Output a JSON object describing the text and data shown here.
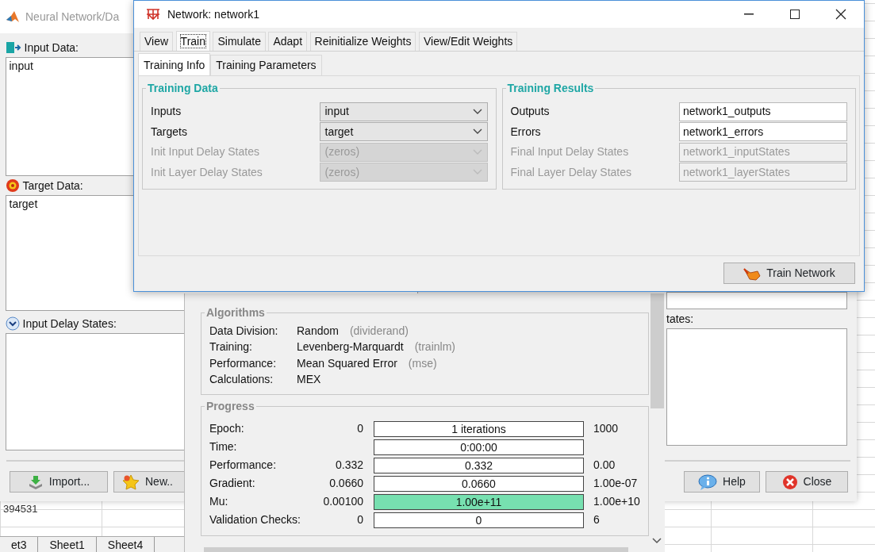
{
  "spreadsheet": {
    "cell_text": "394531",
    "sheet_tabs": [
      {
        "label": "et3"
      },
      {
        "label": "Sheet1"
      },
      {
        "label": "Sheet4"
      }
    ]
  },
  "data_manager": {
    "title": "Neural Network/Da",
    "input_data": {
      "label": "Input Data:",
      "items": [
        "input"
      ]
    },
    "target_data": {
      "label": "Target Data:",
      "items": [
        "target"
      ]
    },
    "input_delay_states": {
      "label": "Input Delay States:"
    },
    "right_states": {
      "label": "tates:"
    },
    "buttons": [
      {
        "label": "Import...",
        "kind": "import"
      },
      {
        "label": "New..",
        "kind": "new"
      },
      {
        "label": "Help",
        "kind": "help"
      },
      {
        "label": "Close",
        "kind": "close"
      }
    ]
  },
  "training_tool": {
    "algorithms": {
      "title": "Algorithms",
      "rows": [
        {
          "label": "Data Division:",
          "value": "Random",
          "function": "(dividerand)"
        },
        {
          "label": "Training:",
          "value": "Levenberg-Marquardt",
          "function": "(trainlm)"
        },
        {
          "label": "Performance:",
          "value": "Mean Squared Error",
          "function": "(mse)"
        },
        {
          "label": "Calculations:",
          "value": "MEX"
        }
      ]
    },
    "progress": {
      "title": "Progress",
      "rows": [
        {
          "label": "Epoch:",
          "start": "0",
          "bar_text": "1 iterations",
          "level": 0,
          "end": "1000"
        },
        {
          "label": "Time:",
          "bar_text": "0:00:00",
          "level": 0
        },
        {
          "label": "Performance:",
          "start": "0.332",
          "bar_text": "0.332",
          "level": 0,
          "end": "0.00"
        },
        {
          "label": "Gradient:",
          "start": "0.0660",
          "bar_text": "0.0660",
          "level": 0,
          "end": "1.00e-07"
        },
        {
          "label": "Mu:",
          "start": "0.00100",
          "bar_text": "1.00e+11",
          "level": 1,
          "end": "1.00e+10"
        },
        {
          "label": "Validation Checks:",
          "start": "0",
          "bar_text": "0",
          "level": 0,
          "end": "6"
        }
      ]
    }
  },
  "network_window": {
    "title": "Network: network1",
    "tabs": [
      {
        "label": "View",
        "selected": false
      },
      {
        "label": "Train",
        "selected": true
      },
      {
        "label": "Simulate",
        "selected": false
      },
      {
        "label": "Adapt",
        "selected": false
      },
      {
        "label": "Reinitialize Weights",
        "selected": false
      },
      {
        "label": "View/Edit Weights",
        "selected": false
      }
    ],
    "subtabs": [
      {
        "label": "Training Info",
        "selected": true
      },
      {
        "label": "Training Parameters",
        "selected": false
      }
    ],
    "training_data": {
      "title": "Training Data",
      "rows": [
        {
          "label": "Inputs",
          "value": "input",
          "disabled": false
        },
        {
          "label": "Targets",
          "value": "target",
          "disabled": false
        },
        {
          "label": "Init Input Delay States",
          "value": "(zeros)",
          "disabled": true
        },
        {
          "label": "Init Layer Delay States",
          "value": "(zeros)",
          "disabled": true
        }
      ]
    },
    "training_results": {
      "title": "Training Results",
      "rows": [
        {
          "label": "Outputs",
          "value": "network1_outputs",
          "disabled": false
        },
        {
          "label": "Errors",
          "value": "network1_errors",
          "disabled": false
        },
        {
          "label": "Final Input Delay States",
          "value": "network1_inputStates",
          "disabled": true
        },
        {
          "label": "Final Layer Delay States",
          "value": "network1_layerStates",
          "disabled": true
        }
      ]
    },
    "train_button": "Train Network"
  }
}
